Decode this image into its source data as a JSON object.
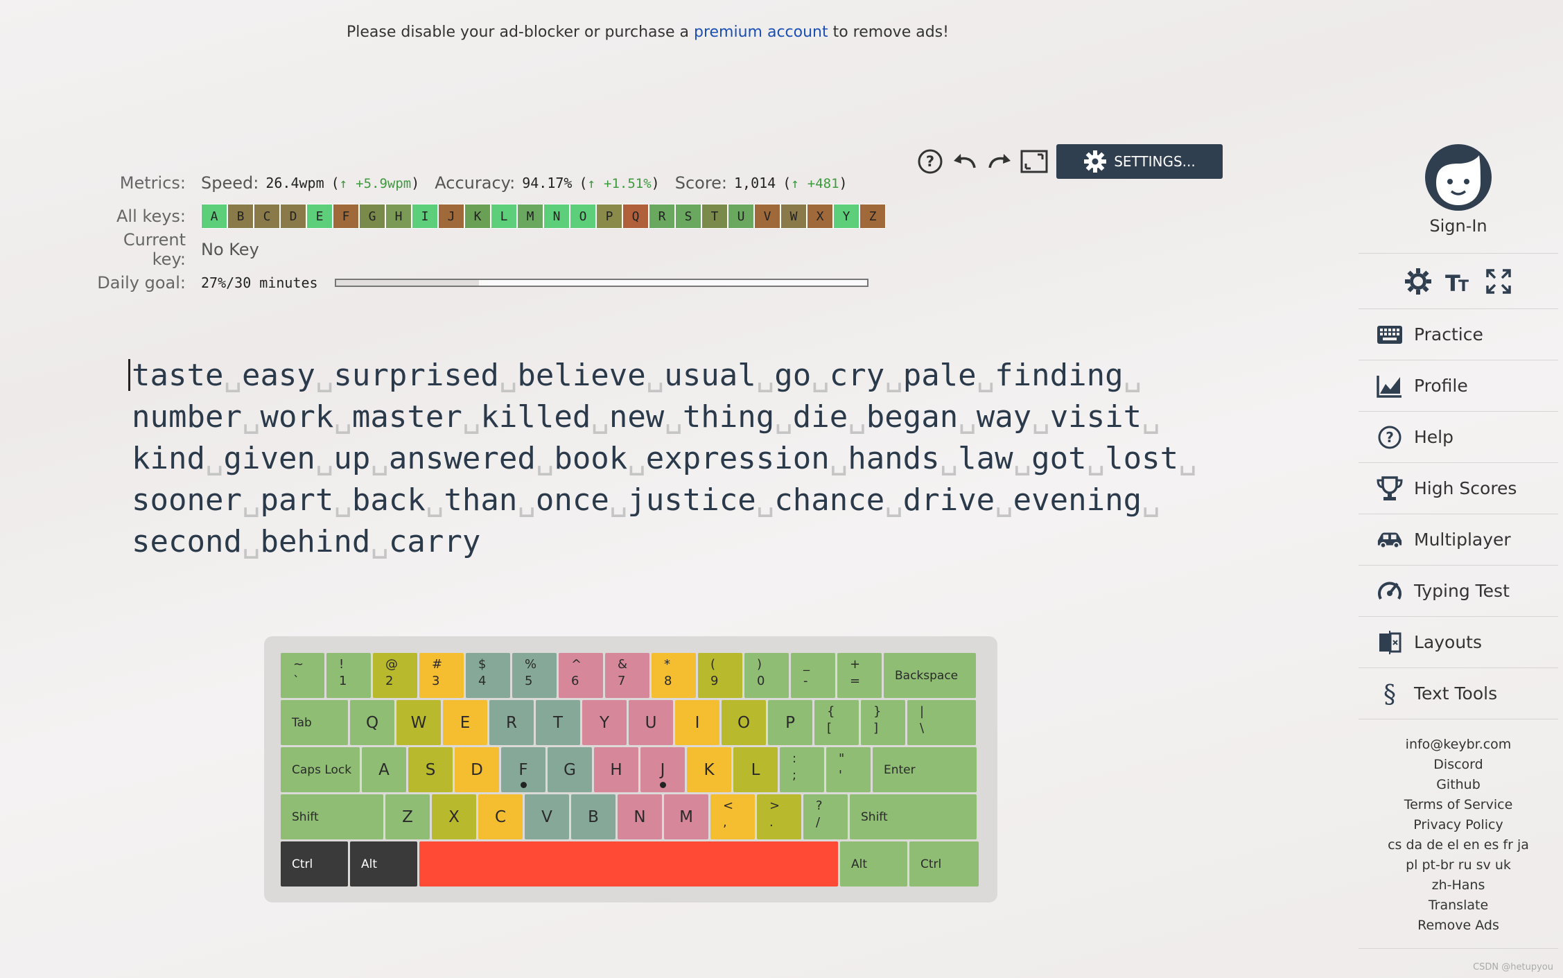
{
  "ad_banner": {
    "prefix": "Please disable your ad-blocker or purchase a ",
    "link": "premium account",
    "suffix": " to remove ads!"
  },
  "metrics": {
    "metrics_label": "Metrics:",
    "speed_label": "Speed:",
    "speed_value": "26.4wpm",
    "speed_gain": "+5.9wpm",
    "accuracy_label": "Accuracy:",
    "accuracy_value": "94.17%",
    "accuracy_gain": "+1.51%",
    "score_label": "Score:",
    "score_value": "1,014",
    "score_gain": "+481",
    "all_keys_label": "All keys:",
    "current_key_label": "Current key:",
    "current_key_value": "No Key",
    "daily_goal_label": "Daily goal:",
    "daily_goal_value": "27%/30 minutes",
    "daily_goal_fraction": 0.27
  },
  "all_keys": [
    {
      "k": "A",
      "c": "#5dcf7a"
    },
    {
      "k": "B",
      "c": "#8a7a4a"
    },
    {
      "k": "C",
      "c": "#8a7a4a"
    },
    {
      "k": "D",
      "c": "#8a7a4a"
    },
    {
      "k": "E",
      "c": "#5dcf7a"
    },
    {
      "k": "F",
      "c": "#a0693a"
    },
    {
      "k": "G",
      "c": "#7a8a4a"
    },
    {
      "k": "H",
      "c": "#7a9a55"
    },
    {
      "k": "I",
      "c": "#5dcf7a"
    },
    {
      "k": "J",
      "c": "#a0693a"
    },
    {
      "k": "K",
      "c": "#6aa055"
    },
    {
      "k": "L",
      "c": "#5dcf7a"
    },
    {
      "k": "M",
      "c": "#6aa860"
    },
    {
      "k": "N",
      "c": "#5dcf7a"
    },
    {
      "k": "O",
      "c": "#5dcf7a"
    },
    {
      "k": "P",
      "c": "#8a8a4a"
    },
    {
      "k": "Q",
      "c": "#b0603a"
    },
    {
      "k": "R",
      "c": "#6aa860"
    },
    {
      "k": "S",
      "c": "#6aa860"
    },
    {
      "k": "T",
      "c": "#7a8a4a"
    },
    {
      "k": "U",
      "c": "#6aa860"
    },
    {
      "k": "V",
      "c": "#a0693a"
    },
    {
      "k": "W",
      "c": "#8a7a4a"
    },
    {
      "k": "X",
      "c": "#a0693a"
    },
    {
      "k": "Y",
      "c": "#5dcf7a"
    },
    {
      "k": "Z",
      "c": "#a0693a"
    }
  ],
  "toolbar": {
    "help_icon": "question-circle-icon",
    "undo_icon": "undo-icon",
    "redo_icon": "redo-icon",
    "zoom_icon": "fullscreen-icon",
    "settings_label": "SETTINGS..."
  },
  "typing_lines": [
    [
      "taste",
      "easy",
      "surprised",
      "believe",
      "usual",
      "go",
      "cry",
      "pale",
      "finding"
    ],
    [
      "number",
      "work",
      "master",
      "killed",
      "new",
      "thing",
      "die",
      "began",
      "way",
      "visit"
    ],
    [
      "kind",
      "given",
      "up",
      "answered",
      "book",
      "expression",
      "hands",
      "law",
      "got",
      "lost"
    ],
    [
      "sooner",
      "part",
      "back",
      "than",
      "once",
      "justice",
      "chance",
      "drive",
      "evening"
    ],
    [
      "second",
      "behind",
      "carry"
    ]
  ],
  "keyboard": {
    "colors": {
      "green": "#8fbd74",
      "olive": "#b8b92c",
      "yellow": "#f5bd30",
      "teal": "#86a898",
      "pink": "#d6879a",
      "dark": "#3a3a3a",
      "red": "#ff4a36"
    },
    "rows": [
      [
        {
          "t": "~",
          "b": "`",
          "c": "green",
          "w": 63
        },
        {
          "t": "!",
          "b": "1",
          "c": "green",
          "w": 64
        },
        {
          "t": "@",
          "b": "2",
          "c": "olive",
          "w": 64
        },
        {
          "t": "#",
          "b": "3",
          "c": "yellow",
          "w": 64
        },
        {
          "t": "$",
          "b": "4",
          "c": "teal",
          "w": 64
        },
        {
          "t": "%",
          "b": "5",
          "c": "teal",
          "w": 64
        },
        {
          "t": "^",
          "b": "6",
          "c": "pink",
          "w": 64
        },
        {
          "t": "&",
          "b": "7",
          "c": "pink",
          "w": 64
        },
        {
          "t": "*",
          "b": "8",
          "c": "yellow",
          "w": 64
        },
        {
          "t": "(",
          "b": "9",
          "c": "olive",
          "w": 64
        },
        {
          "t": ")",
          "b": "0",
          "c": "green",
          "w": 64
        },
        {
          "t": "_",
          "b": "-",
          "c": "green",
          "w": 64
        },
        {
          "t": "+",
          "b": "=",
          "c": "green",
          "w": 64
        },
        {
          "l": "Backspace",
          "c": "green",
          "w": 133
        }
      ],
      [
        {
          "l": "Tab",
          "c": "green",
          "w": 97
        },
        {
          "m": "Q",
          "c": "green",
          "w": 64
        },
        {
          "m": "W",
          "c": "olive",
          "w": 64
        },
        {
          "m": "E",
          "c": "yellow",
          "w": 64
        },
        {
          "m": "R",
          "c": "teal",
          "w": 64
        },
        {
          "m": "T",
          "c": "teal",
          "w": 64
        },
        {
          "m": "Y",
          "c": "pink",
          "w": 64
        },
        {
          "m": "U",
          "c": "pink",
          "w": 64
        },
        {
          "m": "I",
          "c": "yellow",
          "w": 64
        },
        {
          "m": "O",
          "c": "olive",
          "w": 64
        },
        {
          "m": "P",
          "c": "green",
          "w": 64
        },
        {
          "t": "{",
          "b": "[",
          "c": "green",
          "w": 64
        },
        {
          "t": "}",
          "b": "]",
          "c": "green",
          "w": 64
        },
        {
          "t": "|",
          "b": "\\",
          "c": "green",
          "w": 99
        }
      ],
      [
        {
          "l": "Caps Lock",
          "c": "green",
          "w": 114
        },
        {
          "m": "A",
          "c": "green",
          "w": 64
        },
        {
          "m": "S",
          "c": "olive",
          "w": 64
        },
        {
          "m": "D",
          "c": "yellow",
          "w": 64
        },
        {
          "m": "F",
          "c": "teal",
          "w": 64,
          "bump": true
        },
        {
          "m": "G",
          "c": "teal",
          "w": 64
        },
        {
          "m": "H",
          "c": "pink",
          "w": 64
        },
        {
          "m": "J",
          "c": "pink",
          "w": 64,
          "bump": true
        },
        {
          "m": "K",
          "c": "yellow",
          "w": 64
        },
        {
          "m": "L",
          "c": "olive",
          "w": 64
        },
        {
          "t": ":",
          "b": ";",
          "c": "green",
          "w": 64
        },
        {
          "t": "\"",
          "b": "'",
          "c": "green",
          "w": 64
        },
        {
          "l": "Enter",
          "c": "green",
          "w": 150
        }
      ],
      [
        {
          "l": "Shift",
          "c": "green",
          "w": 148
        },
        {
          "m": "Z",
          "c": "green",
          "w": 64
        },
        {
          "m": "X",
          "c": "olive",
          "w": 64
        },
        {
          "m": "C",
          "c": "yellow",
          "w": 64
        },
        {
          "m": "V",
          "c": "teal",
          "w": 64
        },
        {
          "m": "B",
          "c": "teal",
          "w": 64
        },
        {
          "m": "N",
          "c": "pink",
          "w": 64
        },
        {
          "m": "M",
          "c": "pink",
          "w": 64
        },
        {
          "t": "<",
          "b": ",",
          "c": "yellow",
          "w": 64
        },
        {
          "t": ">",
          "b": ".",
          "c": "olive",
          "w": 64
        },
        {
          "t": "?",
          "b": "/",
          "c": "green",
          "w": 64
        },
        {
          "l": "Shift",
          "c": "green",
          "w": 183
        }
      ],
      [
        {
          "l": "Ctrl",
          "c": "dark",
          "w": 97
        },
        {
          "l": "Alt",
          "c": "dark",
          "w": 97
        },
        {
          "m": "",
          "c": "red",
          "w": 604
        },
        {
          "l": "Alt",
          "c": "green",
          "w": 97
        },
        {
          "l": "Ctrl",
          "c": "green",
          "w": 100
        }
      ]
    ]
  },
  "sidebar": {
    "signin_label": "Sign-In",
    "avatar_icon": "user-face-icon",
    "prefs_icons": [
      "theme-icon",
      "font-size-icon",
      "fullscreen-expand-icon"
    ],
    "nav": [
      {
        "id": "practice",
        "label": "Practice",
        "icon": "keyboard-icon"
      },
      {
        "id": "profile",
        "label": "Profile",
        "icon": "chart-icon"
      },
      {
        "id": "help",
        "label": "Help",
        "icon": "question-icon"
      },
      {
        "id": "high-scores",
        "label": "High Scores",
        "icon": "trophy-icon"
      },
      {
        "id": "multiplayer",
        "label": "Multiplayer",
        "icon": "car-icon"
      },
      {
        "id": "typing-test",
        "label": "Typing Test",
        "icon": "speedometer-icon"
      },
      {
        "id": "layouts",
        "label": "Layouts",
        "icon": "layouts-icon"
      },
      {
        "id": "text-tools",
        "label": "Text Tools",
        "icon": "section-icon"
      }
    ],
    "links": [
      "info@keybr.com",
      "Discord",
      "Github",
      "Terms of Service",
      "Privacy Policy",
      "cs da de el en es fr ja",
      "pl pt-br ru sv uk",
      "zh-Hans",
      "Translate",
      "Remove Ads"
    ]
  },
  "watermark": "CSDN @hetupyou"
}
